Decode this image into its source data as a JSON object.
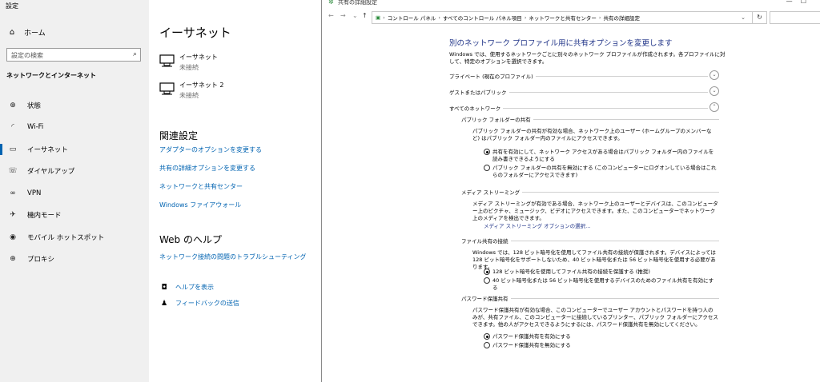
{
  "settings": {
    "title": "設定",
    "home_label": "ホーム",
    "search_placeholder": "設定の検索",
    "section_title": "ネットワークとインターネット",
    "nav": [
      {
        "label": "状態",
        "icon": "home-globe-icon"
      },
      {
        "label": "Wi-Fi",
        "icon": "wifi-icon"
      },
      {
        "label": "イーサネット",
        "icon": "ethernet-icon"
      },
      {
        "label": "ダイヤルアップ",
        "icon": "dialup-icon"
      },
      {
        "label": "VPN",
        "icon": "vpn-icon"
      },
      {
        "label": "機内モード",
        "icon": "airplane-icon"
      },
      {
        "label": "モバイル ホットスポット",
        "icon": "hotspot-icon"
      },
      {
        "label": "プロキシ",
        "icon": "globe-icon"
      }
    ],
    "active_nav": "イーサネット",
    "accent": "#0063b1"
  },
  "main": {
    "title": "イーサネット",
    "adapters": [
      {
        "name": "イーサネット",
        "status": "未接続"
      },
      {
        "name": "イーサネット 2",
        "status": "未接続"
      }
    ],
    "related_title": "関連設定",
    "related_links": [
      "アダプターのオプションを変更する",
      "共有の詳細オプションを変更する",
      "ネットワークと共有センター",
      "Windows ファイアウォール"
    ],
    "web_help_title": "Web のヘルプ",
    "web_help_links": [
      "ネットワーク接続の問題のトラブルシューティング"
    ],
    "help_label": "ヘルプを表示",
    "feedback_label": "フィードバックの送信"
  },
  "control_panel": {
    "window_title": "共有の詳細設定",
    "breadcrumb": [
      "コントロール パネル",
      "すべてのコントロール パネル項目",
      "ネットワークと共有センター",
      "共有の詳細設定"
    ],
    "heading": "別のネットワーク プロファイル用に共有オプションを変更します",
    "description": "Windows では、使用するネットワークごとに別々のネットワーク プロファイルが作成されます。各プロファイルに対して、特定のオプションを選択できます。",
    "profiles": [
      {
        "label": "プライベート (現在のプロファイル)",
        "expanded": false
      },
      {
        "label": "ゲストまたはパブリック",
        "expanded": false
      },
      {
        "label": "すべてのネットワーク",
        "expanded": true
      }
    ],
    "public_folder": {
      "title": "パブリック フォルダーの共有",
      "desc": "パブリック フォルダーの共有が有効な場合、ネットワーク上のユーザー (ホームグループのメンバーなど) はパブリック フォルダー内のファイルにアクセスできます。",
      "options": [
        {
          "label": "共有を有効にして、ネットワーク アクセスがある場合はパブリック フォルダー内のファイルを読み書きできるようにする",
          "selected": true
        },
        {
          "label": "パブリック フォルダーの共有を無効にする (このコンピューターにログオンしている場合はこれらのフォルダーにアクセスできます)",
          "selected": false
        }
      ]
    },
    "media": {
      "title": "メディア ストリーミング",
      "desc": "メディア ストリーミングが有効である場合、ネットワーク上のユーザーとデバイスは、このコンピューター上のピクチャ、ミュージック、ビデオにアクセスできます。また、このコンピューターでネットワーク上のメディアを検出できます。",
      "link": "メディア ストリーミング オプションの選択..."
    },
    "file_sharing": {
      "title": "ファイル共有の接続",
      "desc": "Windows では、128 ビット暗号化を使用してファイル共有の接続が保護されます。デバイスによっては 128 ビット暗号化をサポートしないため、40 ビット暗号化または 56 ビット暗号化を使用する必要があります。",
      "options": [
        {
          "label": "128 ビット暗号化を使用してファイル共有の接続を保護する (推奨)",
          "selected": true
        },
        {
          "label": "40 ビット暗号化または 56 ビット暗号化を使用するデバイスのためのファイル共有を有効にする",
          "selected": false
        }
      ]
    },
    "password": {
      "title": "パスワード保護共有",
      "desc": "パスワード保護共有が有効な場合、このコンピューターでユーザー アカウントとパスワードを持つ人のみが、共有ファイル、このコンピューターに接続しているプリンター、パブリック フォルダーにアクセスできます。他の人がアクセスできるようにするには、パスワード保護共有を無効にしてください。",
      "options": [
        {
          "label": "パスワード保護共有を有効にする",
          "selected": true
        },
        {
          "label": "パスワード保護共有を無効にする",
          "selected": false
        }
      ]
    },
    "heading_color": "#1e3287"
  }
}
